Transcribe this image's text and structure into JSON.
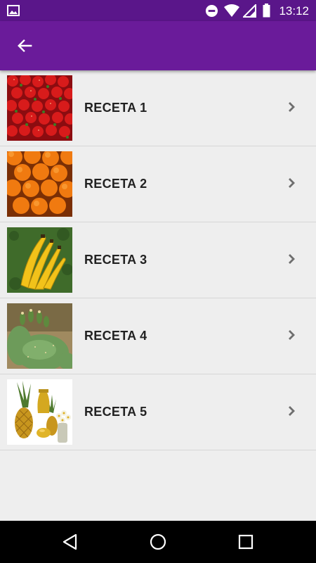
{
  "status_bar": {
    "time": "13:12",
    "icons": [
      "image-icon",
      "do-not-disturb-icon",
      "wifi-icon",
      "signal-icon",
      "battery-icon"
    ]
  },
  "app_bar": {
    "back_icon": "arrow-back-icon"
  },
  "recipes": [
    {
      "label": "RECETA 1",
      "image": "strawberries-image"
    },
    {
      "label": "RECETA 2",
      "image": "oranges-image"
    },
    {
      "label": "RECETA 3",
      "image": "bananas-image"
    },
    {
      "label": "RECETA 4",
      "image": "cactus-nopal-image"
    },
    {
      "label": "RECETA 5",
      "image": "pineapple-image"
    }
  ],
  "nav_bar": {
    "icons": [
      "back-triangle-icon",
      "home-circle-icon",
      "recents-square-icon"
    ]
  },
  "colors": {
    "status_bar": "#5a168a",
    "app_bar": "#6a1b9a",
    "background": "#eeeeee",
    "nav_bar": "#000000"
  }
}
